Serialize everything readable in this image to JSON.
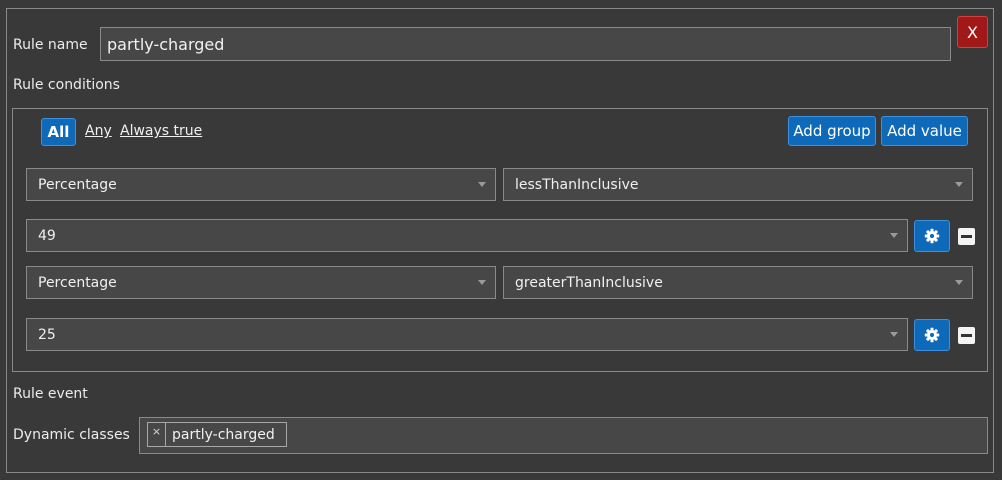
{
  "rule": {
    "name_label": "Rule name",
    "name_value": "partly-charged",
    "close_label": "X",
    "conditions_label": "Rule conditions",
    "event_label": "Rule event",
    "dynamic_classes_label": "Dynamic classes"
  },
  "conditions": {
    "combinators": {
      "all": "All",
      "any": "Any",
      "always": "Always true"
    },
    "add_group_label": "Add group",
    "add_value_label": "Add value",
    "rows": [
      {
        "fact": "Percentage",
        "operator": "lessThanInclusive",
        "value": "49"
      },
      {
        "fact": "Percentage",
        "operator": "greaterThanInclusive",
        "value": "25"
      }
    ]
  },
  "event": {
    "dynamic_classes": [
      "partly-charged"
    ],
    "tag_remove_symbol": "×"
  },
  "colors": {
    "background": "#393939",
    "primary_button": "#0e6ab8",
    "danger_button": "#a01818",
    "border": "#8a8a8a"
  }
}
